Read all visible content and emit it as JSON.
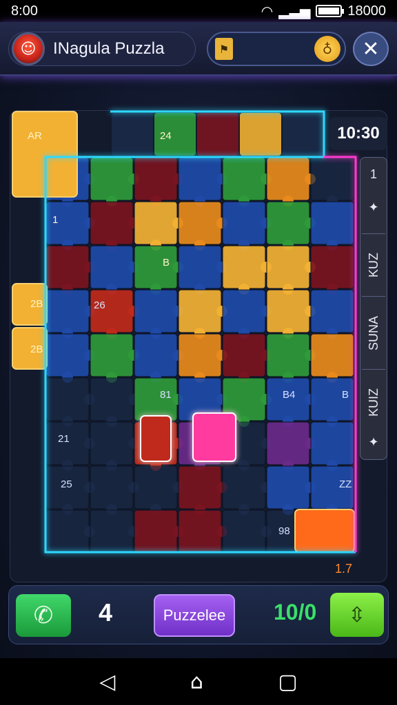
{
  "status_bar": {
    "time": "8:00",
    "right_time": "18000"
  },
  "header": {
    "title": "INagula Puzzla",
    "close_symbol": "✕",
    "coin_symbol": "♁"
  },
  "board": {
    "timer": "10:30",
    "piece_labels": [
      "AR",
      "24",
      "1",
      "B",
      "2B",
      "2B",
      "26",
      "81",
      "B4",
      "B",
      "21",
      "25",
      "ZZ",
      "98"
    ],
    "side_panel": [
      "1",
      "✦",
      "KUZ",
      "SUNA",
      "KUIZ",
      "✦"
    ],
    "corner_label": "1.7"
  },
  "bottom_bar": {
    "count": "4",
    "puzzle_button": "Puzzelee",
    "score": "10/0"
  },
  "colors": {
    "cyan_glow": "#2fd8ff",
    "pink_glow": "#ff3ad0",
    "blue": "#1f4aa8",
    "green": "#2f9a3a",
    "orange": "#e88a1c",
    "red": "#c02a1a",
    "dark_red": "#7a1420",
    "yellow": "#f2b133"
  }
}
